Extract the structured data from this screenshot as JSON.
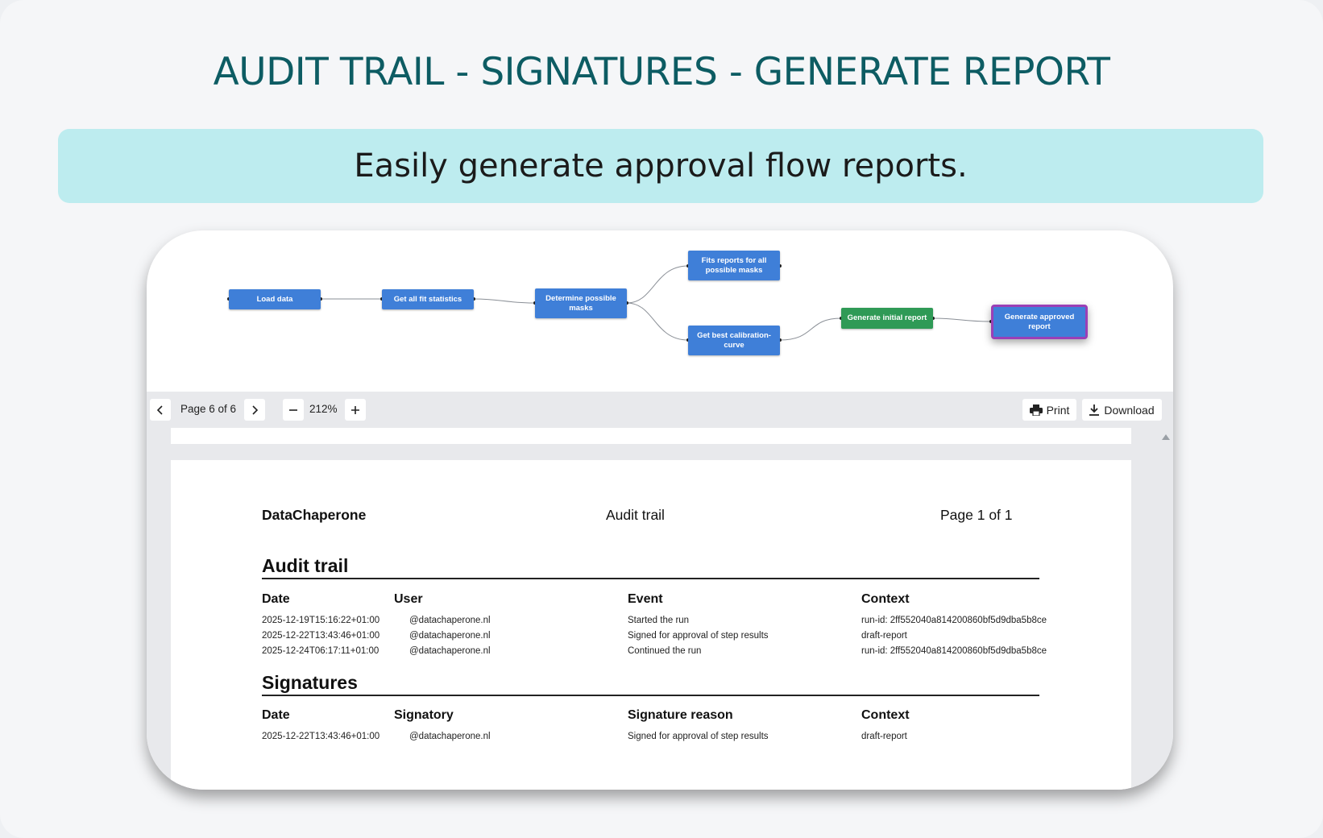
{
  "page": {
    "title": "AUDIT TRAIL - SIGNATURES - GENERATE REPORT",
    "subtitle": "Easily generate approval flow reports."
  },
  "flow": {
    "nodes": [
      {
        "id": "load-data",
        "label": "Load data",
        "color": "#3f7fd8"
      },
      {
        "id": "fit-statistics",
        "label": "Get all fit statistics",
        "color": "#3f7fd8"
      },
      {
        "id": "possible-masks",
        "label": "Determine possible masks",
        "color": "#3f7fd8"
      },
      {
        "id": "fits-reports",
        "label": "Fits reports for all possible masks",
        "color": "#3f7fd8"
      },
      {
        "id": "best-calibration",
        "label": "Get best calibration-curve",
        "color": "#3f7fd8"
      },
      {
        "id": "initial-report",
        "label": "Generate initial report",
        "color": "#2f9a56"
      },
      {
        "id": "approved-report",
        "label": "Generate approved report",
        "color": "#3f7fd8",
        "selected": true
      }
    ]
  },
  "toolbar": {
    "prev_icon": "chevron-left-icon",
    "page_label": "Page 6 of 6",
    "next_icon": "chevron-right-icon",
    "zoom_out_icon": "minus-icon",
    "zoom_level": "212%",
    "zoom_in_icon": "plus-icon",
    "print_label": "Print",
    "download_label": "Download"
  },
  "report": {
    "brand": "DataChaperone",
    "doc_title": "Audit trail",
    "page_info": "Page 1 of 1",
    "audit": {
      "title": "Audit trail",
      "columns": [
        "Date",
        "User",
        "Event",
        "Context"
      ],
      "rows": [
        [
          "2025-12-19T15:16:22+01:00",
          "@datachaperone.nl",
          "Started the run",
          "run-id: 2ff552040a814200860bf5d9dba5b8ce"
        ],
        [
          "2025-12-22T13:43:46+01:00",
          "@datachaperone.nl",
          "Signed for approval of step results",
          "draft-report"
        ],
        [
          "2025-12-24T06:17:11+01:00",
          "@datachaperone.nl",
          "Continued the run",
          "run-id: 2ff552040a814200860bf5d9dba5b8ce"
        ]
      ]
    },
    "signatures": {
      "title": "Signatures",
      "columns": [
        "Date",
        "Signatory",
        "Signature reason",
        "Context"
      ],
      "rows": [
        [
          "2025-12-22T13:43:46+01:00",
          "@datachaperone.nl",
          "Signed for approval of step results",
          "draft-report"
        ]
      ]
    }
  },
  "colors": {
    "title": "#0d5c63",
    "band": "#bdecef",
    "node_blue": "#3f7fd8",
    "node_green": "#2f9a56",
    "selected_border": "#9b3fb6"
  }
}
